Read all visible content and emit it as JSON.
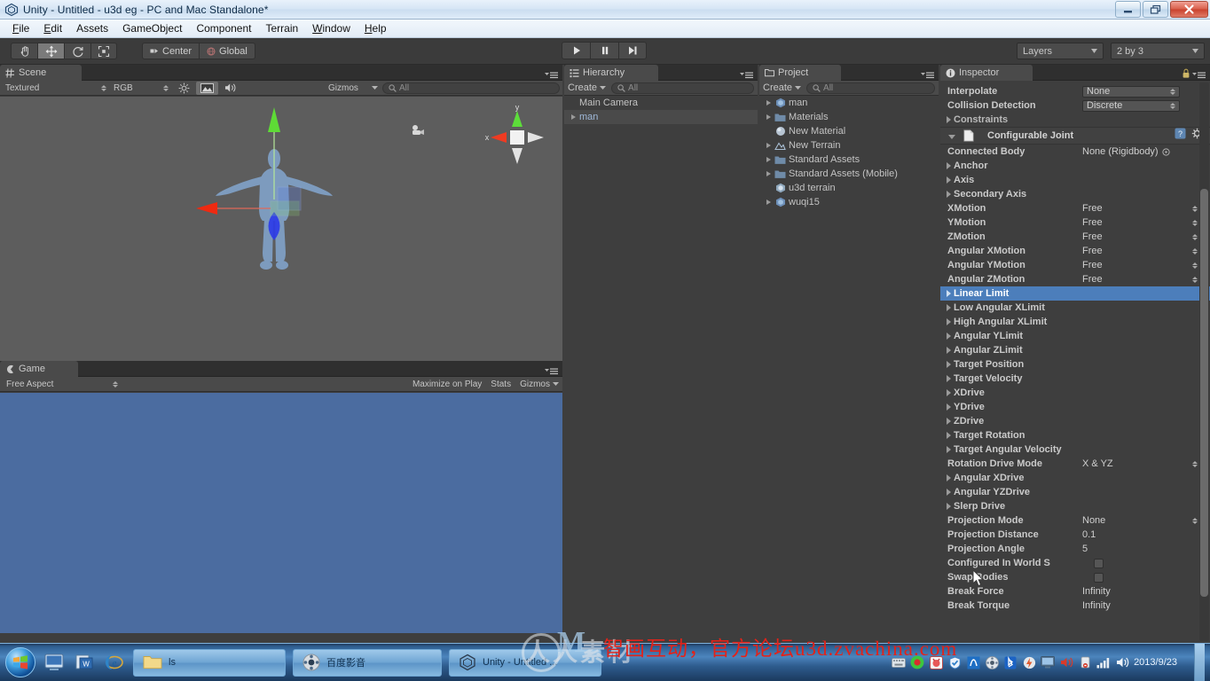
{
  "window": {
    "title": "Unity - Untitled - u3d eg - PC and Mac Standalone*",
    "app_icon": "unity-icon",
    "minimize_label": "Minimize",
    "restore_label": "Restore",
    "close_label": "Close"
  },
  "menubar": {
    "items": [
      {
        "label": "File"
      },
      {
        "label": "Edit"
      },
      {
        "label": "Assets"
      },
      {
        "label": "GameObject"
      },
      {
        "label": "Component"
      },
      {
        "label": "Terrain"
      },
      {
        "label": "Window"
      },
      {
        "label": "Help"
      }
    ]
  },
  "toolbar": {
    "transform_tools": [
      {
        "name": "hand-tool",
        "active": false
      },
      {
        "name": "move-tool",
        "active": true
      },
      {
        "name": "rotate-tool",
        "active": false
      },
      {
        "name": "scale-tool",
        "active": false
      }
    ],
    "pivot_mode": "Center",
    "pivot_rotation": "Global",
    "play": "play-icon",
    "pause": "pause-icon",
    "step": "step-icon",
    "layers_label": "Layers",
    "layout_label": "2 by 3"
  },
  "scene_panel": {
    "tab_label": "Scene",
    "tab_icon": "scene-grid-icon",
    "draw_mode": "Textured",
    "color_mode": "RGB",
    "lighting_icon": "sun-icon",
    "fx_icon": "image-fx-icon",
    "audio_icon": "audio-icon",
    "gizmos_label": "Gizmos",
    "search_placeholder": "All",
    "axis_gizmo": {
      "y_label": "y",
      "x_label": "x"
    },
    "camera_icon": "scene-camera-icon"
  },
  "game_panel": {
    "tab_label": "Game",
    "tab_icon": "game-pad-icon",
    "aspect": "Free Aspect",
    "maximize_on_play": "Maximize on Play",
    "stats": "Stats",
    "gizmos": "Gizmos"
  },
  "hierarchy_panel": {
    "tab_label": "Hierarchy",
    "tab_icon": "hierarchy-icon",
    "create_label": "Create",
    "search_placeholder": "All",
    "items": [
      {
        "label": "Main Camera",
        "expandable": false,
        "selected": false
      },
      {
        "label": "man",
        "expandable": true,
        "selected": true
      }
    ]
  },
  "project_panel": {
    "tab_label": "Project",
    "tab_icon": "folder-icon",
    "create_label": "Create",
    "search_placeholder": "All",
    "items": [
      {
        "label": "man",
        "icon": "prefab-icon",
        "expandable": true
      },
      {
        "label": "Materials",
        "icon": "folder-icon",
        "expandable": true
      },
      {
        "label": "New Material",
        "icon": "material-icon",
        "expandable": false
      },
      {
        "label": "New Terrain",
        "icon": "terrain-icon",
        "expandable": true
      },
      {
        "label": "Standard Assets",
        "icon": "folder-icon",
        "expandable": true
      },
      {
        "label": "Standard Assets (Mobile)",
        "icon": "folder-icon",
        "expandable": true
      },
      {
        "label": "u3d terrain",
        "icon": "unity-scene-icon",
        "expandable": false
      },
      {
        "label": "wuqi15",
        "icon": "prefab-icon",
        "expandable": true
      }
    ]
  },
  "inspector_panel": {
    "tab_label": "Inspector",
    "tab_icon": "info-icon",
    "lock_icon": "lock-icon",
    "menu_icon": "hamburger-icon",
    "rigidbody_rows": [
      {
        "label": "Interpolate",
        "type": "dropdown",
        "value": "None"
      },
      {
        "label": "Collision Detection",
        "type": "dropdown",
        "value": "Discrete"
      },
      {
        "label": "Constraints",
        "type": "foldout",
        "value": ""
      }
    ],
    "component": {
      "title": "Configurable Joint",
      "icon": "script-icon",
      "help_icon": "help-icon",
      "gear_icon": "gear-icon"
    },
    "joint_rows": [
      {
        "label": "Connected Body",
        "type": "object",
        "value": "None (Rigidbody)"
      },
      {
        "label": "Anchor",
        "type": "foldout",
        "value": ""
      },
      {
        "label": "Axis",
        "type": "foldout",
        "value": ""
      },
      {
        "label": "Secondary Axis",
        "type": "foldout",
        "value": ""
      },
      {
        "label": "XMotion",
        "type": "enum",
        "value": "Free"
      },
      {
        "label": "YMotion",
        "type": "enum",
        "value": "Free"
      },
      {
        "label": "ZMotion",
        "type": "enum",
        "value": "Free"
      },
      {
        "label": "Angular XMotion",
        "type": "enum",
        "value": "Free"
      },
      {
        "label": "Angular YMotion",
        "type": "enum",
        "value": "Free"
      },
      {
        "label": "Angular ZMotion",
        "type": "enum",
        "value": "Free"
      },
      {
        "label": "Linear Limit",
        "type": "foldout",
        "value": "",
        "highlighted": true
      },
      {
        "label": "Low Angular XLimit",
        "type": "foldout",
        "value": ""
      },
      {
        "label": "High Angular XLimit",
        "type": "foldout",
        "value": ""
      },
      {
        "label": "Angular YLimit",
        "type": "foldout",
        "value": ""
      },
      {
        "label": "Angular ZLimit",
        "type": "foldout",
        "value": ""
      },
      {
        "label": "Target Position",
        "type": "foldout",
        "value": ""
      },
      {
        "label": "Target Velocity",
        "type": "foldout",
        "value": ""
      },
      {
        "label": "XDrive",
        "type": "foldout",
        "value": ""
      },
      {
        "label": "YDrive",
        "type": "foldout",
        "value": ""
      },
      {
        "label": "ZDrive",
        "type": "foldout",
        "value": ""
      },
      {
        "label": "Target Rotation",
        "type": "foldout",
        "value": ""
      },
      {
        "label": "Target Angular Velocity",
        "type": "foldout",
        "value": ""
      },
      {
        "label": "Rotation Drive Mode",
        "type": "enum",
        "value": "X & YZ"
      },
      {
        "label": "Angular XDrive",
        "type": "foldout",
        "value": ""
      },
      {
        "label": "Angular YZDrive",
        "type": "foldout",
        "value": ""
      },
      {
        "label": "Slerp Drive",
        "type": "foldout",
        "value": ""
      },
      {
        "label": "Projection Mode",
        "type": "enum",
        "value": "None"
      },
      {
        "label": "Projection Distance",
        "type": "text",
        "value": "0.1"
      },
      {
        "label": "Projection Angle",
        "type": "text",
        "value": "5"
      },
      {
        "label": "Configured In World S",
        "type": "checkbox",
        "value": ""
      },
      {
        "label": "Swap Bodies",
        "type": "checkbox",
        "value": ""
      },
      {
        "label": "Break Force",
        "type": "text",
        "value": "Infinity"
      },
      {
        "label": "Break Torque",
        "type": "text",
        "value": "Infinity"
      }
    ]
  },
  "taskbar": {
    "start_label": "Start",
    "quick_launch": [
      {
        "name": "show-desktop-icon"
      },
      {
        "name": "office-icon"
      },
      {
        "name": "internet-explorer-icon"
      }
    ],
    "tasks": [
      {
        "label": "ls",
        "icon": "folder-icon"
      },
      {
        "label": "百度影音",
        "icon": "baidu-player-icon"
      },
      {
        "label": "Unity - Untitled ...",
        "icon": "unity-icon"
      }
    ],
    "tray_icons": [
      "keyboard-icon",
      "ime-icon",
      "devil-icon",
      "security-shield-icon",
      "tencent-icon",
      "media-icon",
      "bluetooth-icon",
      "flash-icon",
      "monitor-icon",
      "speaker-red-icon",
      "usb-eject-icon",
      "signal-icon",
      "volume-icon"
    ],
    "clock_date": "2013/9/23"
  },
  "watermarks": {
    "red_text": "智画互动，官方论坛u3d.zvachina.com",
    "gray_text": "人人素材"
  },
  "colors": {
    "unity_bg": "#3e3e3e",
    "panel_tab": "#4a4a4a",
    "highlight_blue": "#4c7ebb",
    "game_sky": "#4b6ca0",
    "scene_bg": "#5d5d5d",
    "title_text": "#0d2b47"
  }
}
